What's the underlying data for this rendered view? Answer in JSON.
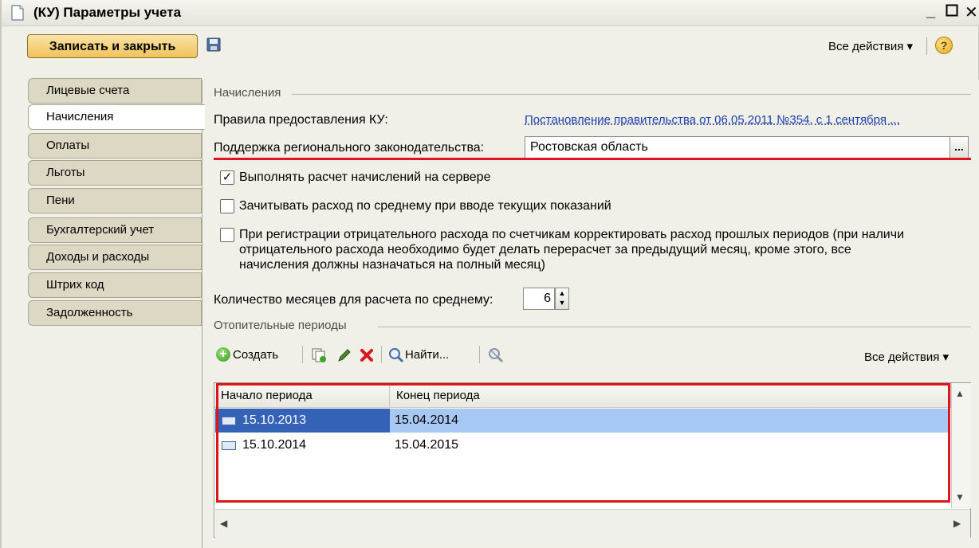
{
  "window": {
    "title": "(КУ) Параметры учета"
  },
  "toolbar": {
    "save_close_label": "Записать и закрыть",
    "all_actions_label": "Все действия ▾",
    "help_label": "?"
  },
  "tabs": [
    {
      "label": "Лицевые счета",
      "active": false
    },
    {
      "label": "Начисления",
      "active": true
    },
    {
      "label": "Оплаты",
      "active": false
    },
    {
      "label": "Льготы",
      "active": false
    },
    {
      "label": "Пени",
      "active": false
    },
    {
      "label": "Бухгалтерский учет",
      "active": false
    },
    {
      "label": "Доходы и расходы",
      "active": false
    },
    {
      "label": "Штрих код",
      "active": false
    },
    {
      "label": "Задолженность",
      "active": false
    }
  ],
  "accruals": {
    "group_title": "Начисления",
    "rules_label": "Правила предоставления КУ:",
    "rules_link": "Постановление правительства от 06.05.2011 №354, с 1 сентября ...",
    "regional_label": "Поддержка регионального законодательства:",
    "regional_value": "Ростовская область",
    "ellipsis": "...",
    "checkbox_server_label": "Выполнять расчет начислений на сервере",
    "checkbox_server_checked": true,
    "checkbox_avg_label": "Зачитывать расход по среднему при вводе текущих показаний",
    "checkbox_avg_checked": false,
    "checkbox_negative_line1": "При регистрации отрицательного расхода по счетчикам корректировать расход прошлых периодов (при наличи",
    "checkbox_negative_line2": "отрицательного расхода необходимо будет делать перерасчет за предыдущий месяц, кроме этого, все",
    "checkbox_negative_line3": "начисления должны назначаться на полный месяц)",
    "checkbox_negative_checked": false,
    "months_label": "Количество месяцев для расчета по среднему:",
    "months_value": "6"
  },
  "heating": {
    "group_title": "Отопительные периоды",
    "create_label": "Создать",
    "find_label": "Найти...",
    "all_actions_label": "Все действия ▾",
    "columns": [
      "Начало периода",
      "Конец периода"
    ],
    "rows": [
      {
        "start": "15.10.2013",
        "end": "15.04.2014",
        "selected": true
      },
      {
        "start": "15.10.2014",
        "end": "15.04.2015",
        "selected": false
      }
    ]
  },
  "colors": {
    "accent_button": "#f0c35a",
    "highlight_red": "#e0141e",
    "selection_row": "#a8c8f4",
    "selection_cell": "#3462b6",
    "link": "#1f3fae"
  },
  "icons": {
    "title": "document-icon",
    "save": "disk-icon",
    "help": "help-icon",
    "create": "plus-icon",
    "copy": "copy-icon",
    "edit": "pencil-icon",
    "delete": "delete-x-icon",
    "find": "magnifier-icon",
    "clear_search": "clear-search-icon"
  }
}
